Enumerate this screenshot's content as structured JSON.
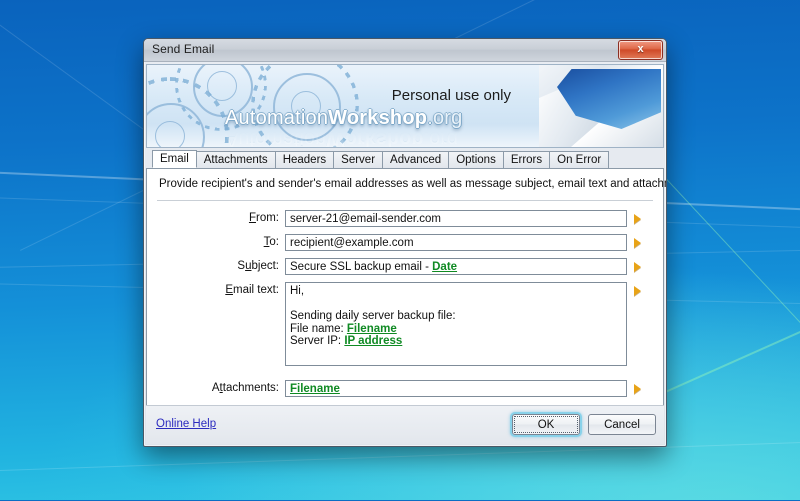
{
  "window": {
    "title": "Send Email",
    "close_label": "x"
  },
  "banner": {
    "personal_use": "Personal use only",
    "brand_prefix": "Automation",
    "brand_bold": "Workshop",
    "brand_suffix": ".org"
  },
  "tabs": [
    {
      "label": "Email",
      "active": true
    },
    {
      "label": "Attachments",
      "active": false
    },
    {
      "label": "Headers",
      "active": false
    },
    {
      "label": "Server",
      "active": false
    },
    {
      "label": "Advanced",
      "active": false
    },
    {
      "label": "Options",
      "active": false
    },
    {
      "label": "Errors",
      "active": false
    },
    {
      "label": "On Error",
      "active": false
    }
  ],
  "description": "Provide recipient's and sender's email addresses as well as message subject, email text and attachments.",
  "fields": {
    "from": {
      "label_pre": "F",
      "label_key": "r",
      "label_post": "om:",
      "label_full": "From:",
      "value": "server-21@email-sender.com"
    },
    "to": {
      "label_full": "To:",
      "value": "recipient@example.com"
    },
    "subject": {
      "label_full": "Subject:",
      "value_plain": "Secure SSL backup email - ",
      "value_token": "Date"
    },
    "email_text": {
      "label_full": "Email text:",
      "line1": "Hi,",
      "line2": "",
      "line3": "Sending daily server backup file:",
      "line4_label": "File name: ",
      "line4_token": "Filename",
      "line5_label": "Server IP: ",
      "line5_token": "IP address"
    },
    "attachments": {
      "label_full": "Attachments:",
      "value_token": "Filename"
    }
  },
  "footer": {
    "help_label": "Online Help",
    "ok_label": "OK",
    "cancel_label": "Cancel"
  },
  "colors": {
    "token_green": "#0f8a23",
    "link_blue": "#2b2bbf",
    "arrow_amber": "#e8a317",
    "close_red": "#cf4a28",
    "focus_cyan": "#89d2ea"
  }
}
